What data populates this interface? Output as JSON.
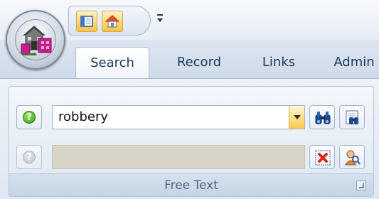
{
  "tabs": [
    {
      "label": "Search",
      "active": true
    },
    {
      "label": "Record",
      "active": false
    },
    {
      "label": "Links",
      "active": false
    },
    {
      "label": "Admin",
      "active": false
    }
  ],
  "quick_access": {
    "buttons": [
      {
        "icon": "panel-layout-icon"
      },
      {
        "icon": "home-icon"
      }
    ],
    "customize_icon": "qat-customize-icon"
  },
  "ribbon": {
    "group_caption": "Free Text",
    "search_field": {
      "value": "robbery"
    },
    "second_field": {
      "value": "",
      "disabled": true
    },
    "buttons": {
      "find": {
        "icon": "binoculars-icon"
      },
      "advanced_find": {
        "icon": "advanced-find-icon"
      },
      "clear": {
        "icon": "clear-x-icon"
      },
      "person": {
        "icon": "person-search-icon"
      }
    }
  },
  "colors": {
    "accent": "#1e395b",
    "ribbon_bg": "#dfe7f1",
    "qat_highlight": "#ffd776"
  }
}
